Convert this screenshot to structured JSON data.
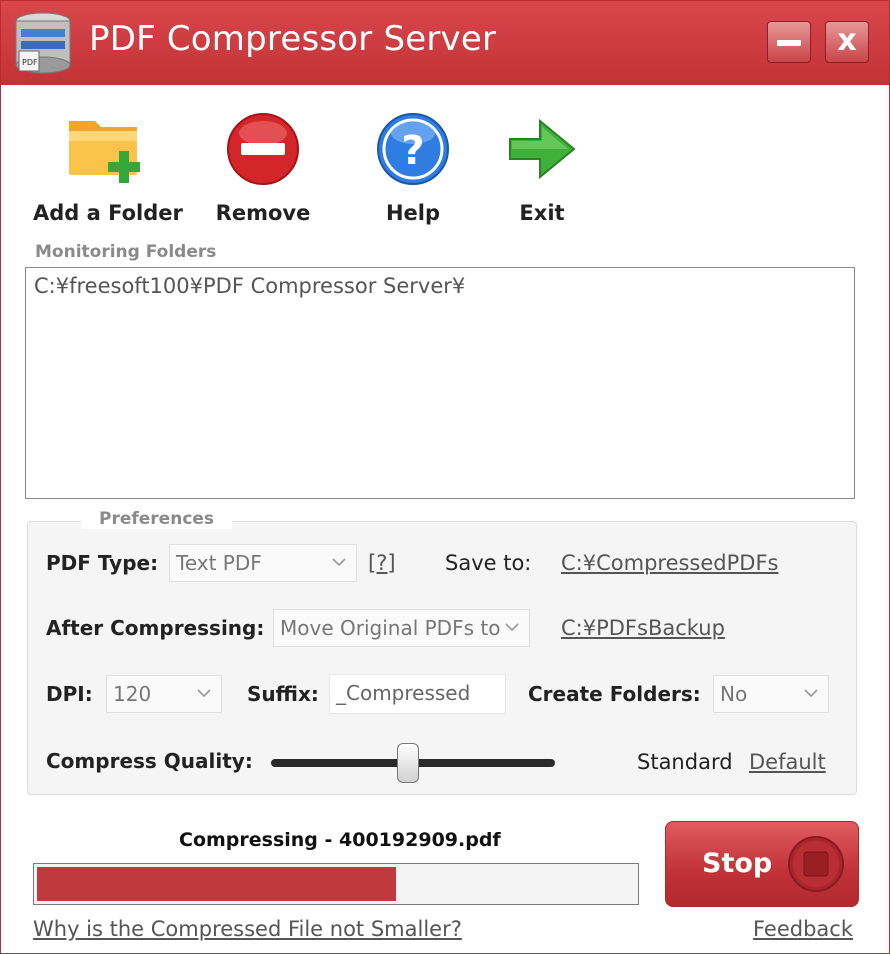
{
  "window": {
    "title": "PDF Compressor Server"
  },
  "toolbar": {
    "add_folder": "Add a Folder",
    "remove": "Remove",
    "help": "Help",
    "exit": "Exit"
  },
  "monitoring": {
    "label": "Monitoring Folders",
    "items": [
      "C:¥freesoft100¥PDF Compressor Server¥"
    ]
  },
  "preferences": {
    "legend": "Preferences",
    "pdf_type_label": "PDF Type:",
    "pdf_type_value": "Text PDF",
    "pdf_type_help": "[?]",
    "save_to_label": "Save to:",
    "save_to_path": "C:¥CompressedPDFs",
    "after_label": "After Compressing:",
    "after_value": "Move Original PDFs to",
    "backup_path": "C:¥PDFsBackup",
    "dpi_label": "DPI:",
    "dpi_value": "120",
    "suffix_label": "Suffix:",
    "suffix_value": "_Compressed",
    "create_folders_label": "Create Folders:",
    "create_folders_value": "No",
    "quality_label": "Compress Quality:",
    "quality_fraction": 0.48,
    "quality_value": "Standard",
    "default_link": "Default"
  },
  "status": {
    "text": "Compressing - 400192909.pdf",
    "progress_percent": 60,
    "stop_label": "Stop"
  },
  "footer": {
    "why_link": "Why is the Compressed File not Smaller?",
    "feedback_link": "Feedback"
  },
  "colors": {
    "accent": "#c23237",
    "progress": "#c0393d"
  }
}
